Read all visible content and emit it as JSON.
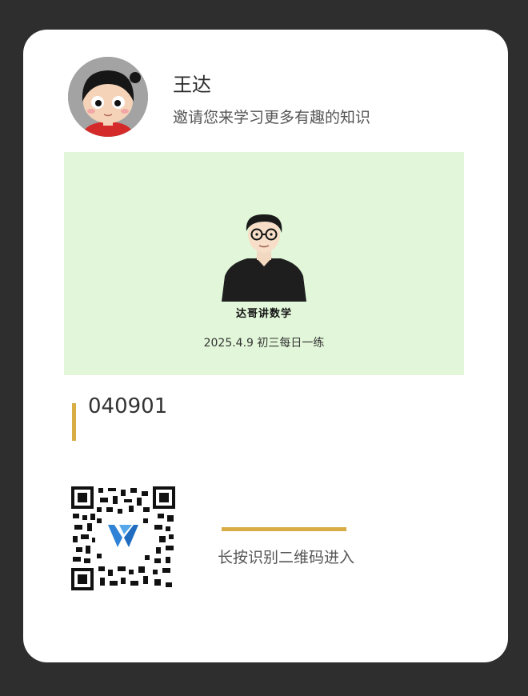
{
  "profile": {
    "name": "王达",
    "invite_text": "邀请您来学习更多有趣的知识"
  },
  "banner": {
    "brand": "达哥讲数学",
    "caption": "2025.4.9 初三每日一练"
  },
  "code": {
    "value": "040901"
  },
  "qr": {
    "hint": "长按识别二维码进入"
  },
  "colors": {
    "page_background": "#2e2e2e",
    "card_background": "#ffffff",
    "banner_background": "#e2f7d9",
    "accent": "#d8ad46"
  }
}
